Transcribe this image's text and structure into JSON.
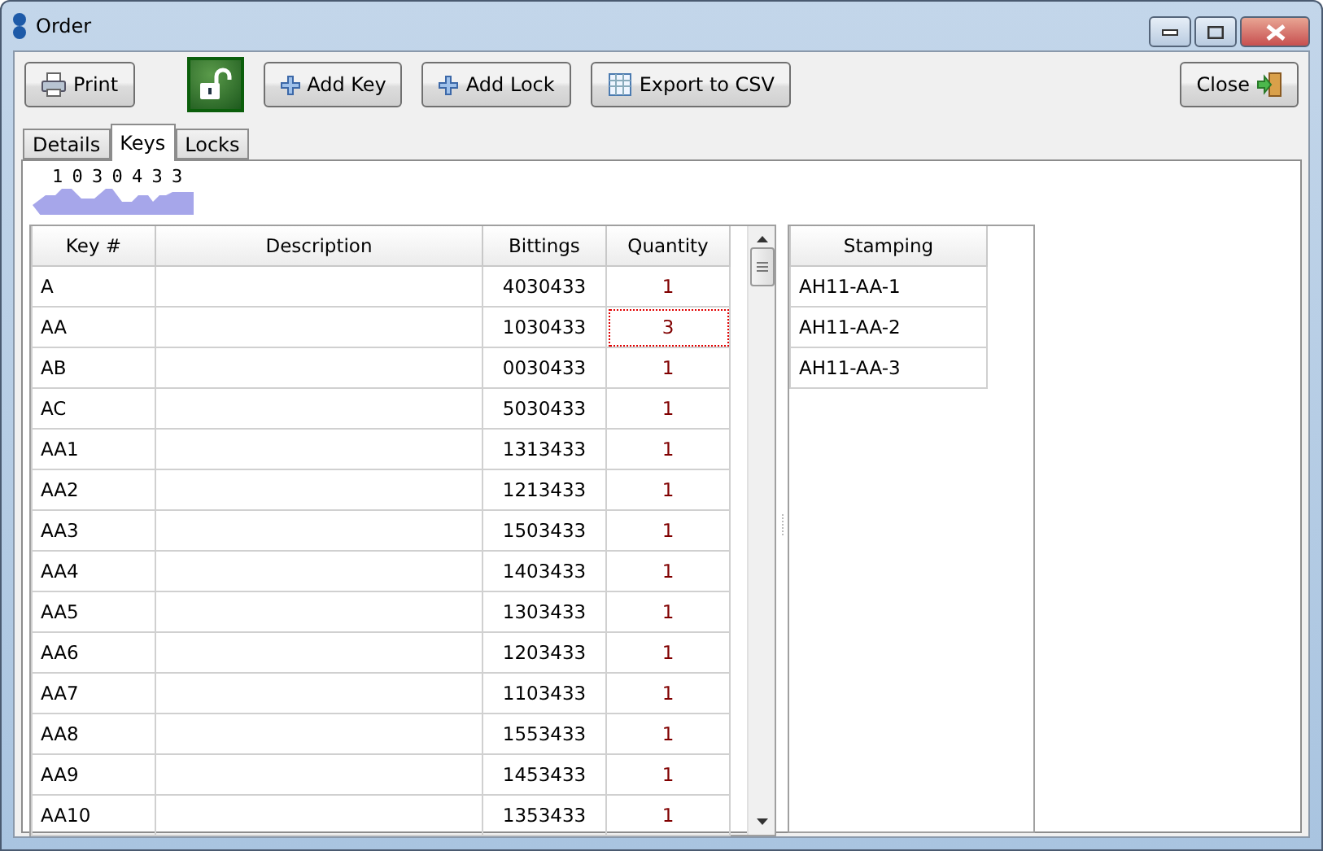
{
  "window": {
    "title": "Order"
  },
  "toolbar": {
    "print": "Print",
    "lock": {
      "locked": false
    },
    "add_key": "Add Key",
    "add_lock": "Add Lock",
    "export": "Export to CSV",
    "close": "Close"
  },
  "tabs": [
    {
      "label": "Details",
      "selected": false
    },
    {
      "label": "Keys",
      "selected": true
    },
    {
      "label": "Locks",
      "selected": false
    }
  ],
  "key_preview": {
    "bitting": "1 0 3 0 4 3 3"
  },
  "keys_table": {
    "columns": [
      "Key #",
      "Description",
      "Bittings",
      "Quantity"
    ],
    "rows": [
      {
        "key": "A",
        "description": "",
        "bittings": "4030433",
        "quantity": "1",
        "focused": false
      },
      {
        "key": "AA",
        "description": "",
        "bittings": "1030433",
        "quantity": "3",
        "focused": true
      },
      {
        "key": "AB",
        "description": "",
        "bittings": "0030433",
        "quantity": "1",
        "focused": false
      },
      {
        "key": "AC",
        "description": "",
        "bittings": "5030433",
        "quantity": "1",
        "focused": false
      },
      {
        "key": "AA1",
        "description": "",
        "bittings": "1313433",
        "quantity": "1",
        "focused": false
      },
      {
        "key": "AA2",
        "description": "",
        "bittings": "1213433",
        "quantity": "1",
        "focused": false
      },
      {
        "key": "AA3",
        "description": "",
        "bittings": "1503433",
        "quantity": "1",
        "focused": false
      },
      {
        "key": "AA4",
        "description": "",
        "bittings": "1403433",
        "quantity": "1",
        "focused": false
      },
      {
        "key": "AA5",
        "description": "",
        "bittings": "1303433",
        "quantity": "1",
        "focused": false
      },
      {
        "key": "AA6",
        "description": "",
        "bittings": "1203433",
        "quantity": "1",
        "focused": false
      },
      {
        "key": "AA7",
        "description": "",
        "bittings": "1103433",
        "quantity": "1",
        "focused": false
      },
      {
        "key": "AA8",
        "description": "",
        "bittings": "1553433",
        "quantity": "1",
        "focused": false
      },
      {
        "key": "AA9",
        "description": "",
        "bittings": "1453433",
        "quantity": "1",
        "focused": false
      },
      {
        "key": "AA10",
        "description": "",
        "bittings": "1353433",
        "quantity": "1",
        "focused": false
      }
    ]
  },
  "stamping_table": {
    "columns": [
      "Stamping"
    ],
    "rows": [
      "AH11-AA-1",
      "AH11-AA-2",
      "AH11-AA-3"
    ]
  }
}
